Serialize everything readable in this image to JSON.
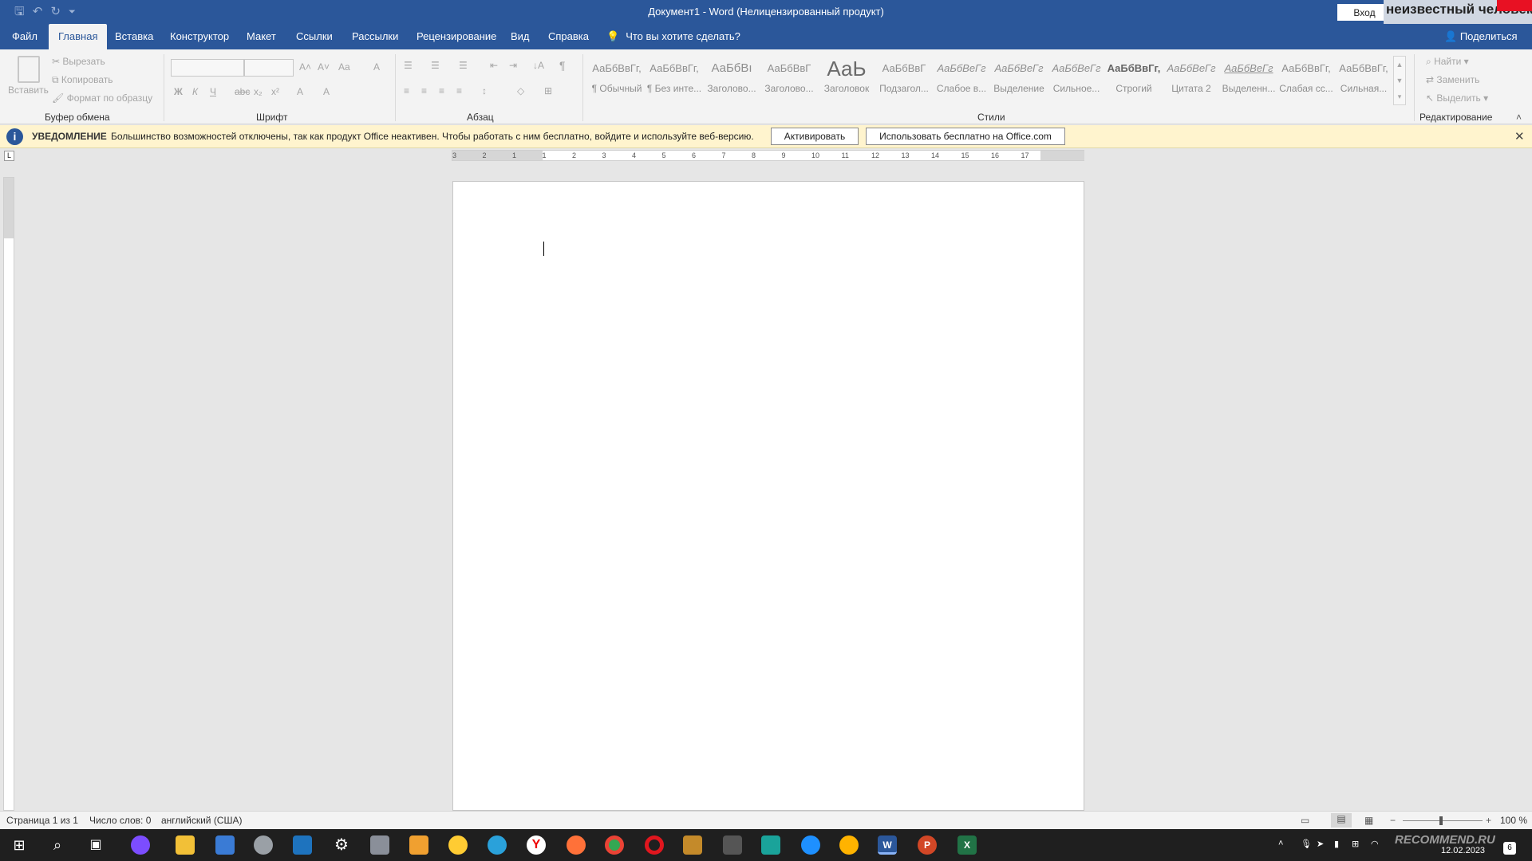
{
  "title_bar": {
    "title": "Документ1  -  Word (Нелицензированный продукт)",
    "login_label": "Вход",
    "user_name": "неизвестный человек",
    "qat_save": "🖫",
    "qat_undo": "↶",
    "qat_redo": "↻",
    "qat_more": "⏷"
  },
  "tabs": [
    "Файл",
    "Главная",
    "Вставка",
    "Конструктор",
    "Макет",
    "Ссылки",
    "Рассылки",
    "Рецензирование",
    "Вид",
    "Справка"
  ],
  "tell_me": "Что вы хотите сделать?",
  "share": "Поделиться",
  "ribbon": {
    "clipboard": {
      "paste": "Вставить",
      "cut": "Вырезать",
      "copy": "Копировать",
      "format_painter": "Формат по образцу",
      "label": "Буфер обмена"
    },
    "font": {
      "label": "Шрифт",
      "bold": "Ж",
      "italic": "К",
      "underline": "Ч",
      "strike": "abc",
      "sub": "x₂",
      "sup": "x²",
      "grow": "A˄",
      "shrink": "A˅",
      "case": "Aa",
      "clear": "A",
      "effects": "A",
      "highlight": "A",
      "color": "A"
    },
    "paragraph": {
      "label": "Абзац",
      "pilcrow": "¶",
      "sort": "↓A"
    },
    "styles": {
      "label": "Стили",
      "items": [
        {
          "sample": "АаБбВвГг,",
          "name": "¶ Обычный"
        },
        {
          "sample": "АаБбВвГг,",
          "name": "¶ Без инте..."
        },
        {
          "sample": "АаБбВı",
          "name": "Заголово..."
        },
        {
          "sample": "АаБбВвГ",
          "name": "Заголово..."
        },
        {
          "sample": "АаЬ",
          "name": "Заголовок"
        },
        {
          "sample": "АаБбВвГ",
          "name": "Подзагол..."
        },
        {
          "sample": "АаБбВеГг",
          "name": "Слабое в..."
        },
        {
          "sample": "АаБбВеГг",
          "name": "Выделение"
        },
        {
          "sample": "АаБбВеГг",
          "name": "Сильное..."
        },
        {
          "sample": "АаБбВвГг,",
          "name": "Строгий"
        },
        {
          "sample": "АаБбВеГг",
          "name": "Цитата 2"
        },
        {
          "sample": "АаБбВеГг",
          "name": "Выделенн..."
        },
        {
          "sample": "АаБбВвГг,",
          "name": "Слабая сс..."
        },
        {
          "sample": "АаБбВвГг,",
          "name": "Сильная..."
        }
      ]
    },
    "editing": {
      "label": "Редактирование",
      "find": "Найти",
      "replace": "Заменить",
      "select": "Выделить"
    }
  },
  "notification": {
    "title": "УВЕДОМЛЕНИЕ",
    "message": "Большинство возможностей отключены, так как продукт Office неактивен. Чтобы работать с ним бесплатно, войдите и используйте веб-версию.",
    "activate": "Активировать",
    "use_free": "Использовать бесплатно на Office.com",
    "close": "✕"
  },
  "ruler": {
    "tab_selector": "L",
    "ticks": [
      "3",
      "2",
      "1",
      "1",
      "2",
      "3",
      "4",
      "5",
      "6",
      "7",
      "8",
      "9",
      "10",
      "11",
      "12",
      "13",
      "14",
      "15",
      "16",
      "17"
    ]
  },
  "status_bar": {
    "page": "Страница 1 из 1",
    "words": "Число слов: 0",
    "language": "английский (США)",
    "zoom": "100 %",
    "zoom_minus": "−",
    "zoom_plus": "+"
  },
  "taskbar": {
    "date": "12.02.2023",
    "notif_count": "6",
    "watermark": "RECOMMEND.RU"
  },
  "colors": {
    "accent": "#2b579a",
    "notify_bg": "#fff4ce",
    "user_flag": "#e81123"
  }
}
